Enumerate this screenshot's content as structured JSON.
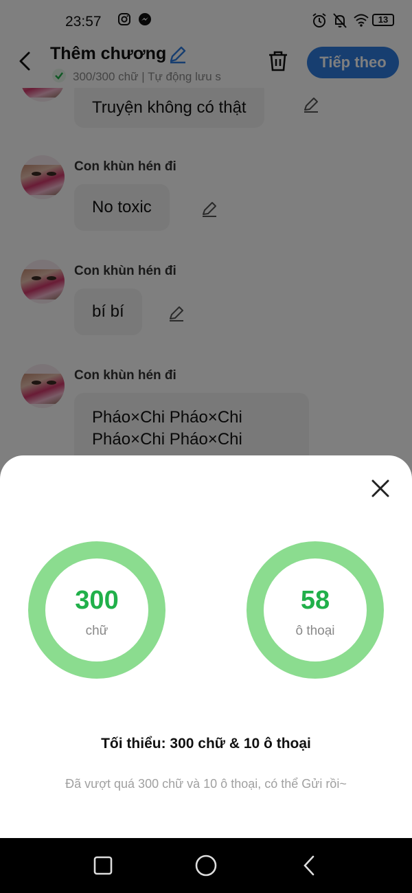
{
  "status_bar": {
    "time": "23:57",
    "battery": "13",
    "left_icons": [
      "instagram-icon",
      "messenger-icon"
    ],
    "right_icons": [
      "alarm-icon",
      "bell-off-icon",
      "wifi-icon",
      "battery-icon"
    ]
  },
  "header": {
    "title": "Thêm chương",
    "subtitle": "300/300 chữ | Tự động lưu s",
    "next_label": "Tiếp theo",
    "accent": "#2e7de0"
  },
  "messages": [
    {
      "sender": "",
      "text": "Truyện không có thật"
    },
    {
      "sender": "Con khùn hén đi",
      "text": "No toxic"
    },
    {
      "sender": "Con khùn hén đi",
      "text": "bí bí"
    },
    {
      "sender": "Con khùn hén đi",
      "text": "Pháo×Chi Pháo×Chi\nPháo×Chi Pháo×Chi"
    }
  ],
  "sheet": {
    "words_value": "300",
    "words_unit": "chữ",
    "dialogs_value": "58",
    "dialogs_unit": "ô thoại",
    "minimum": "Tối thiểu: 300 chữ & 10 ô thoại",
    "note": "Đã vượt quá 300 chữ và 10 ô thoại, có thể Gửi rồi~",
    "ring_color": "#8bdc8f",
    "number_color": "#21b04a"
  }
}
